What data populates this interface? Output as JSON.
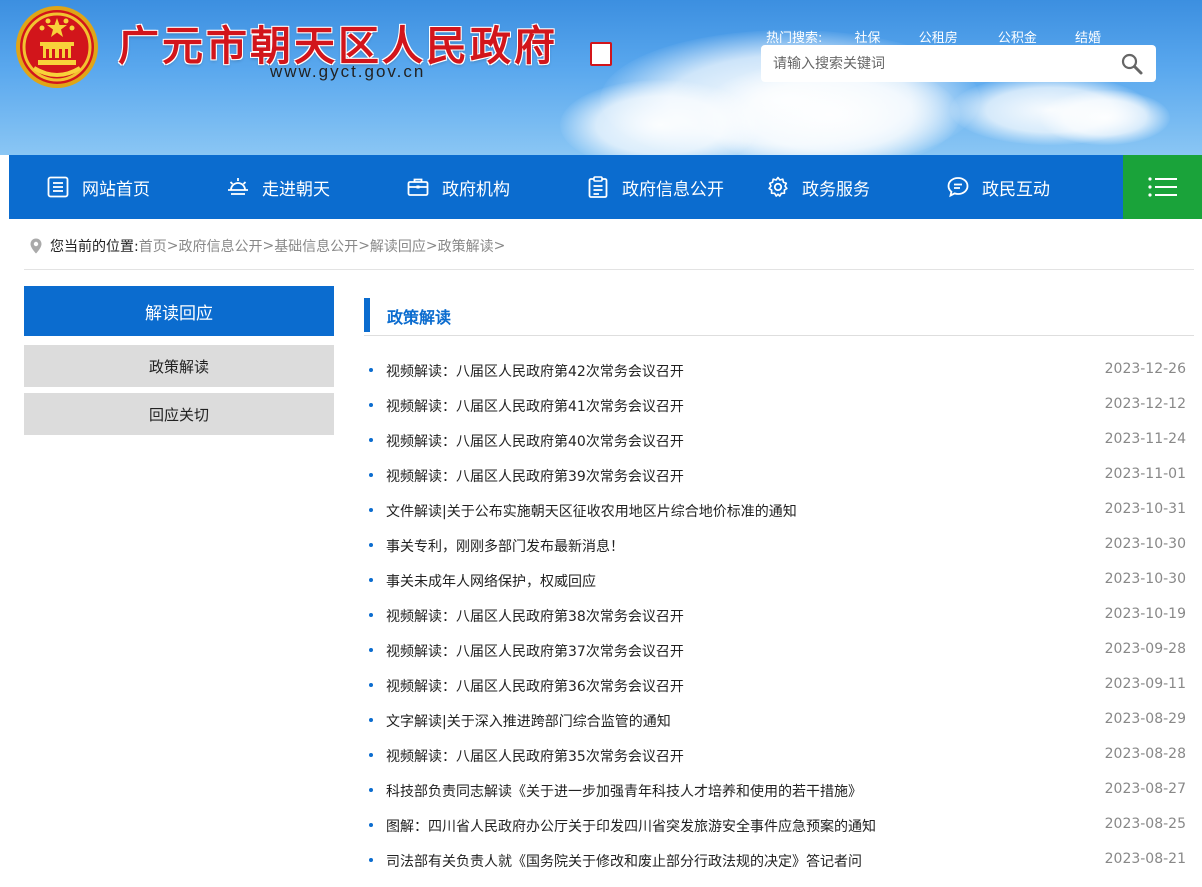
{
  "header": {
    "title": "广元市朝天区人民政府",
    "url": "www.gyct.gov.cn",
    "hot_label": "热门搜索:",
    "hot_links": [
      "社保",
      "公租房",
      "公积金",
      "结婚"
    ],
    "search_placeholder": "请输入搜索关键词"
  },
  "nav": {
    "items": [
      {
        "label": "网站首页",
        "icon": "list-icon"
      },
      {
        "label": "走进朝天",
        "icon": "sunrise-icon"
      },
      {
        "label": "政府机构",
        "icon": "briefcase-icon"
      },
      {
        "label": "政府信息公开",
        "icon": "clipboard-icon"
      },
      {
        "label": "政务服务",
        "icon": "gear-icon"
      },
      {
        "label": "政民互动",
        "icon": "chat-icon"
      }
    ],
    "menu_icon": "hamburger-icon"
  },
  "breadcrumb": {
    "label": "您当前的位置:",
    "items": [
      "首页",
      "政府信息公开",
      "基础信息公开",
      "解读回应",
      "政策解读"
    ],
    "separator": ">"
  },
  "sidebar": {
    "heading": "解读回应",
    "items": [
      "政策解读",
      "回应关切"
    ]
  },
  "main": {
    "column_title": "政策解读",
    "articles": [
      {
        "title": "视频解读：八届区人民政府第42次常务会议召开",
        "date": "2023-12-26"
      },
      {
        "title": "视频解读：八届区人民政府第41次常务会议召开",
        "date": "2023-12-12"
      },
      {
        "title": "视频解读：八届区人民政府第40次常务会议召开",
        "date": "2023-11-24"
      },
      {
        "title": "视频解读：八届区人民政府第39次常务会议召开",
        "date": "2023-11-01"
      },
      {
        "title": "文件解读|关于公布实施朝天区征收农用地区片综合地价标准的通知",
        "date": "2023-10-31"
      },
      {
        "title": "事关专利，刚刚多部门发布最新消息！",
        "date": "2023-10-30"
      },
      {
        "title": "事关未成年人网络保护，权威回应",
        "date": "2023-10-30"
      },
      {
        "title": "视频解读：八届区人民政府第38次常务会议召开",
        "date": "2023-10-19"
      },
      {
        "title": "视频解读：八届区人民政府第37次常务会议召开",
        "date": "2023-09-28"
      },
      {
        "title": "视频解读：八届区人民政府第36次常务会议召开",
        "date": "2023-09-11"
      },
      {
        "title": "文字解读|关于深入推进跨部门综合监管的通知",
        "date": "2023-08-29"
      },
      {
        "title": "视频解读：八届区人民政府第35次常务会议召开",
        "date": "2023-08-28"
      },
      {
        "title": "科技部负责同志解读《关于进一步加强青年科技人才培养和使用的若干措施》",
        "date": "2023-08-27"
      },
      {
        "title": "图解：四川省人民政府办公厅关于印发四川省突发旅游安全事件应急预案的通知",
        "date": "2023-08-25"
      },
      {
        "title": "司法部有关负责人就《国务院关于修改和废止部分行政法规的决定》答记者问",
        "date": "2023-08-21"
      }
    ]
  },
  "colors": {
    "primary_blue": "#0b6ccf",
    "menu_green": "#1aa33a",
    "title_red": "#d2151b",
    "sidebar_gray": "#dcdcdc"
  }
}
